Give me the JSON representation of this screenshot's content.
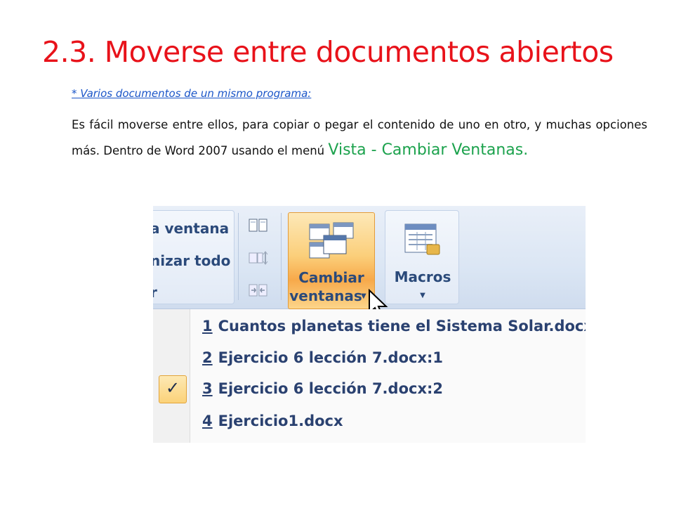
{
  "slide": {
    "title": "2.3. Moverse entre documentos abiertos",
    "subtitle": "* Varios documentos de un mismo programa:",
    "paragraph_text": "Es fácil moverse entre ellos, para copiar o pegar el contenido de uno en otro, y muchas opciones más. Dentro de Word 2007 usando el menú ",
    "paragraph_highlight": "Vista - Cambiar Ventanas.",
    "colors": {
      "title": "#e8121a",
      "subtitle": "#1a55c8",
      "highlight": "#1ca24d"
    }
  },
  "ribbon": {
    "window_commands": [
      "a ventana",
      "nizar todo",
      "r"
    ],
    "switch_windows_label_line1": "Cambiar",
    "switch_windows_label_line2": "ventanas",
    "macros_label": "Macros",
    "icons": [
      "side-by-side-icon",
      "synchronous-scroll-icon",
      "reset-window-icon",
      "switch-windows-icon",
      "macros-icon",
      "dropdown-arrow-icon",
      "mouse-cursor-icon"
    ]
  },
  "menu": {
    "items": [
      {
        "num": "1",
        "label": "Cuantos planetas tiene el Sistema Solar.docx",
        "checked": false
      },
      {
        "num": "2",
        "label": "Ejercicio 6 lección 7.docx:1",
        "checked": false
      },
      {
        "num": "3",
        "label": "Ejercicio 6 lección 7.docx:2",
        "checked": true
      },
      {
        "num": "4",
        "label": "Ejercicio1.docx",
        "checked": false
      }
    ],
    "check_glyph": "✓"
  }
}
